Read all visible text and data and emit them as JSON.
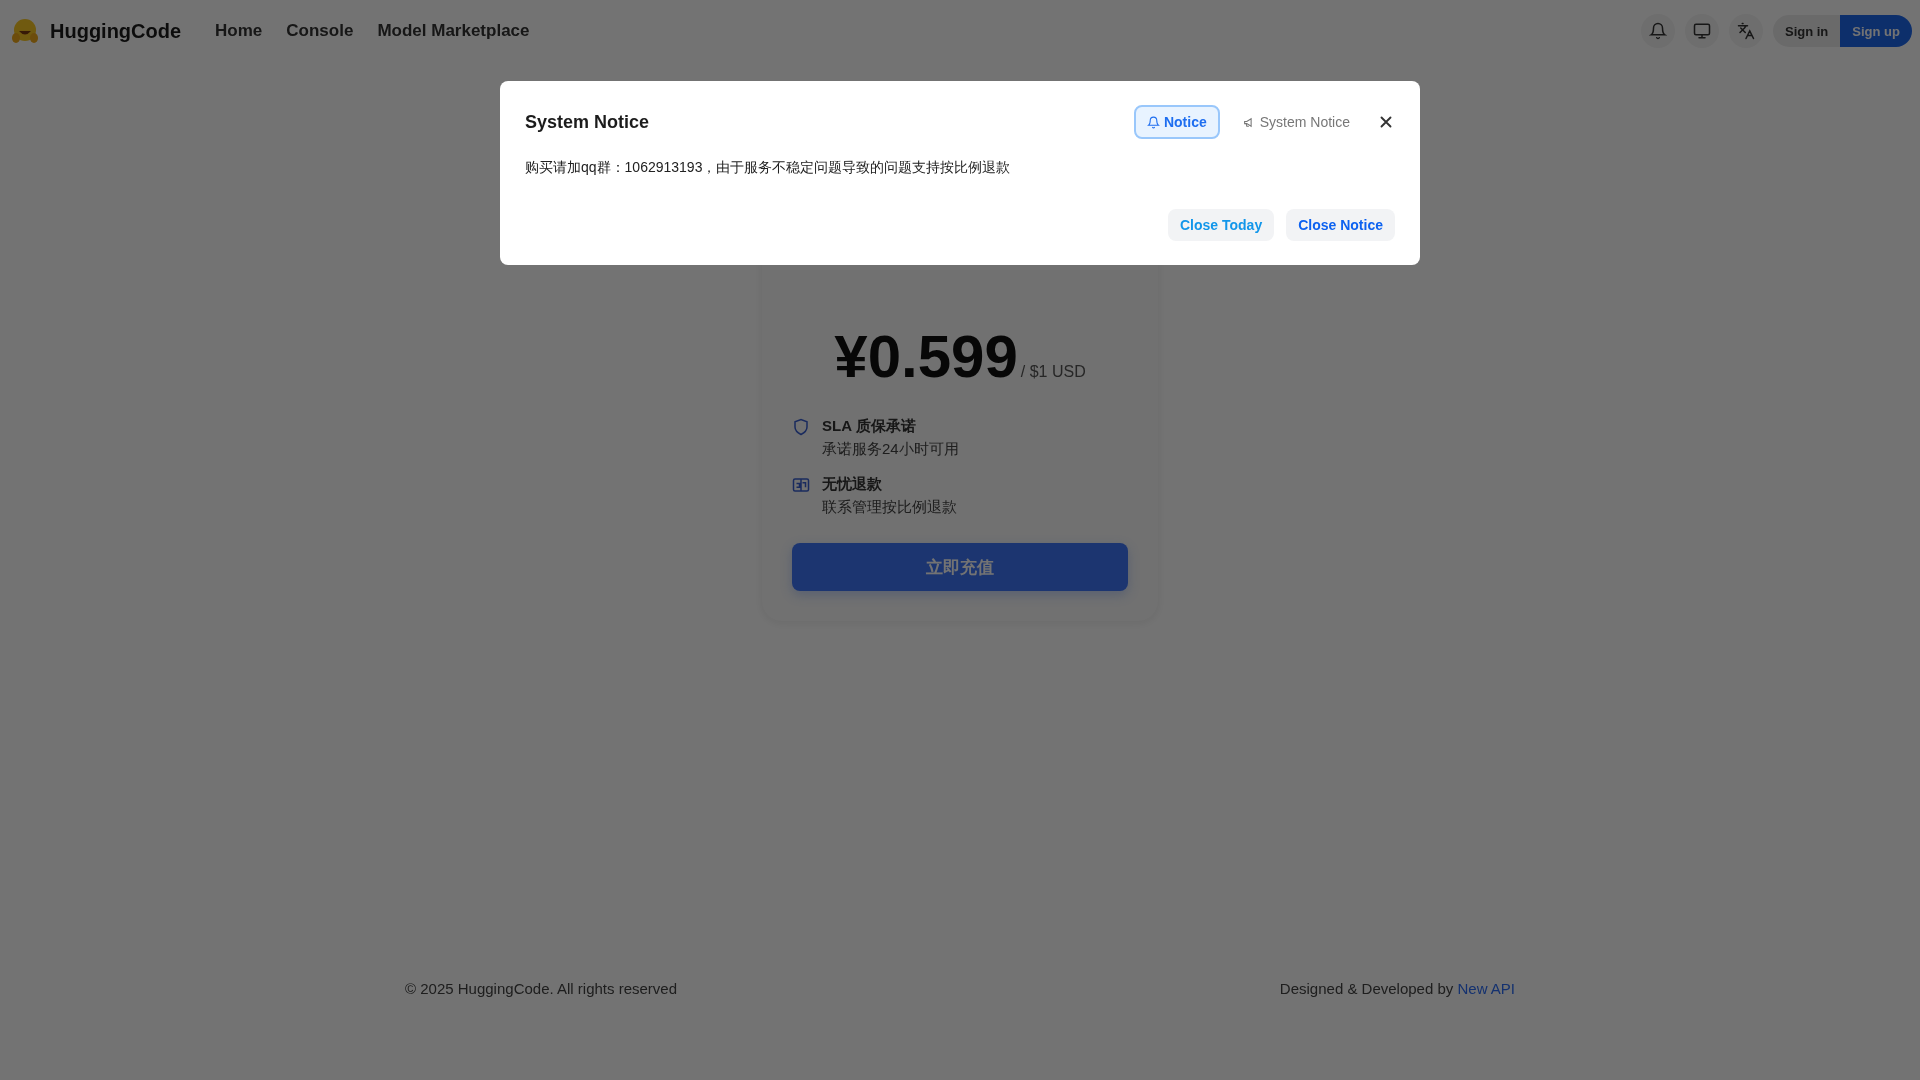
{
  "header": {
    "brand": "HuggingCode",
    "nav": [
      {
        "label": "Home"
      },
      {
        "label": "Console"
      },
      {
        "label": "Model Marketplace"
      }
    ],
    "sign_in": "Sign in",
    "sign_up": "Sign up"
  },
  "card": {
    "price": "¥0.599",
    "unit": "/ $1 USD",
    "features": [
      {
        "kind": "shield",
        "title": "SLA 质保承诺",
        "subtitle": "承诺服务24小时可用"
      },
      {
        "kind": "refund",
        "title": "无忧退款",
        "subtitle": "联系管理按比例退款"
      }
    ],
    "button": "立即充值"
  },
  "footer": {
    "copyright": "© 2025 HuggingCode. All rights reserved",
    "credit": "Designed & Developed by",
    "credit_link": "New API"
  },
  "modal": {
    "title": "System Notice",
    "tabs": [
      {
        "kind": "bell",
        "label": "Notice",
        "selected": true
      },
      {
        "kind": "megaphone",
        "label": "System Notice",
        "selected": false
      }
    ],
    "message": "购买请加qq群：1062913193，由于服务不稳定问题导致的问题支持按比例退款",
    "buttons": [
      {
        "kind": "secondary",
        "label": "Close Today"
      },
      {
        "kind": "primary",
        "label": "Close Notice"
      }
    ]
  }
}
